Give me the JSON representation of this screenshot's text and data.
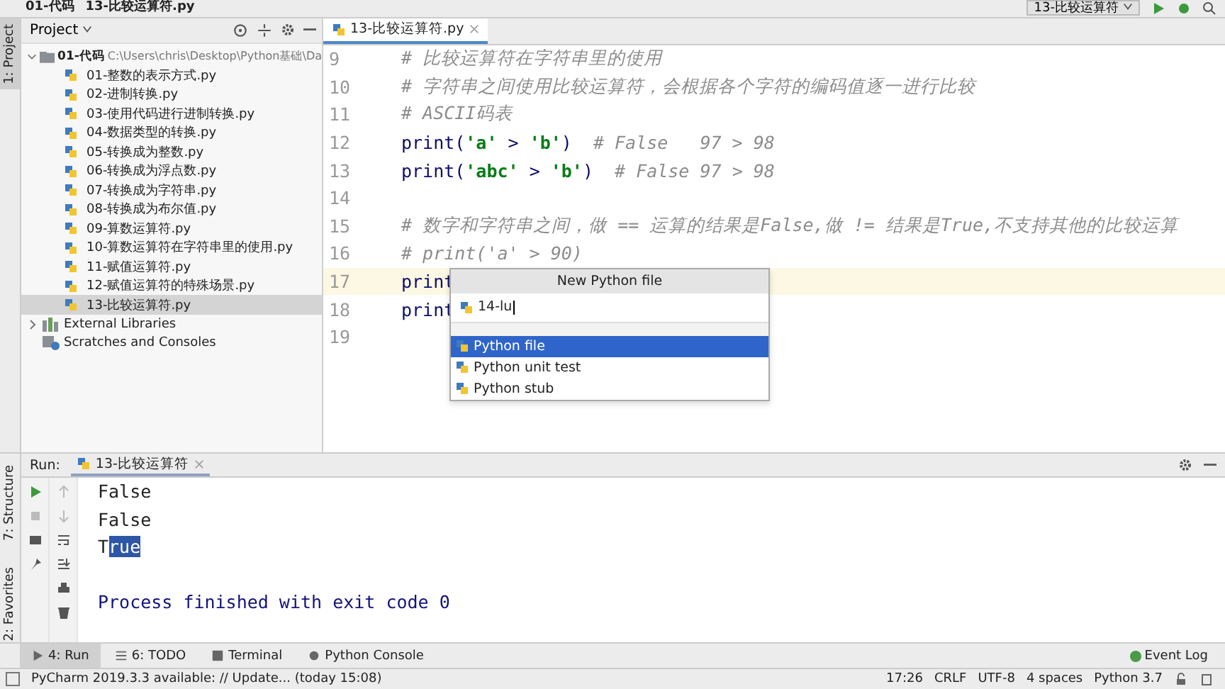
{
  "breadcrumb": [
    "01-代码",
    "13-比较运算符.py"
  ],
  "run_config": "13-比较运算符",
  "left_tool_tabs": [
    {
      "label": "1: Project",
      "selected": true
    },
    {
      "label": "7: Structure",
      "selected": false
    },
    {
      "label": "2: Favorites",
      "selected": false
    }
  ],
  "project": {
    "title": "Project",
    "root": {
      "name": "01-代码",
      "path": "C:\\Users\\chris\\Desktop\\Python基础\\Da",
      "expanded": true,
      "children": [
        {
          "name": "01-整数的表示方式.py",
          "selected": false
        },
        {
          "name": "02-进制转换.py",
          "selected": false
        },
        {
          "name": "03-使用代码进行进制转换.py",
          "selected": false
        },
        {
          "name": "04-数据类型的转换.py",
          "selected": false
        },
        {
          "name": "05-转换成为整数.py",
          "selected": false
        },
        {
          "name": "06-转换成为浮点数.py",
          "selected": false
        },
        {
          "name": "07-转换成为字符串.py",
          "selected": false
        },
        {
          "name": "08-转换成为布尔值.py",
          "selected": false
        },
        {
          "name": "09-算数运算符.py",
          "selected": false
        },
        {
          "name": "10-算数运算符在字符串里的使用.py",
          "selected": false
        },
        {
          "name": "11-赋值运算符.py",
          "selected": false
        },
        {
          "name": "12-赋值运算符的特殊场景.py",
          "selected": false
        },
        {
          "name": "13-比较运算符.py",
          "selected": true
        }
      ]
    },
    "others": [
      {
        "name": "External Libraries",
        "kind": "library"
      },
      {
        "name": "Scratches and Consoles",
        "kind": "scratch"
      }
    ]
  },
  "editor": {
    "tab": "13-比较运算符.py",
    "lines": [
      {
        "number": "9",
        "current": false,
        "segments": [
          {
            "kind": "comment",
            "text": "# 比较运算符在字符串里的使用"
          }
        ]
      },
      {
        "number": "10",
        "current": false,
        "segments": [
          {
            "kind": "comment",
            "text": "# 字符串之间使用比较运算符，会根据各个字符的编码值逐一进行比较"
          }
        ]
      },
      {
        "number": "11",
        "current": false,
        "segments": [
          {
            "kind": "comment",
            "text": "# ASCII码表"
          }
        ]
      },
      {
        "number": "12",
        "current": false,
        "segments": [
          {
            "kind": "plain",
            "text": "print("
          },
          {
            "kind": "string",
            "text": "'a'"
          },
          {
            "kind": "plain",
            "text": " > "
          },
          {
            "kind": "string",
            "text": "'b'"
          },
          {
            "kind": "plain",
            "text": ")  "
          },
          {
            "kind": "comment",
            "text": "# False   97 > 98"
          }
        ]
      },
      {
        "number": "13",
        "current": false,
        "segments": [
          {
            "kind": "plain",
            "text": "print("
          },
          {
            "kind": "string",
            "text": "'abc'"
          },
          {
            "kind": "plain",
            "text": " > "
          },
          {
            "kind": "string",
            "text": "'b'"
          },
          {
            "kind": "plain",
            "text": ")  "
          },
          {
            "kind": "comment",
            "text": "# False 97 > 98"
          }
        ]
      },
      {
        "number": "14",
        "current": false
      },
      {
        "number": "15",
        "current": false,
        "segments": [
          {
            "kind": "comment",
            "text": "# 数字和字符串之间，做 == 运算的结果是False,做 != 结果是True,不支持其他的比较运算"
          }
        ]
      },
      {
        "number": "16",
        "current": false,
        "segments": [
          {
            "kind": "comment",
            "text": "# print('a' > 90)"
          }
        ]
      },
      {
        "number": "17",
        "current": true,
        "segments": [
          {
            "kind": "plain",
            "text": "print"
          }
        ]
      },
      {
        "number": "18",
        "current": false,
        "segments": [
          {
            "kind": "plain",
            "text": "print"
          }
        ]
      },
      {
        "number": "19",
        "current": false
      }
    ]
  },
  "popup": {
    "title": "New Python file",
    "value": "14-lu",
    "options": [
      {
        "label": "Python file",
        "selected": true
      },
      {
        "label": "Python unit test",
        "selected": false
      },
      {
        "label": "Python stub",
        "selected": false
      }
    ]
  },
  "run": {
    "label": "Run:",
    "tab": "13-比较运算符",
    "output": [
      {
        "segments": [
          {
            "text": "False",
            "selected": false
          }
        ]
      },
      {
        "segments": [
          {
            "text": "False",
            "selected": false
          }
        ]
      },
      {
        "segments": [
          {
            "text": "T",
            "selected": false
          },
          {
            "text": "rue",
            "selected": true
          }
        ]
      }
    ],
    "exit": "Process finished with exit code 0"
  },
  "bottom_tabs": [
    {
      "label": "4: Run",
      "kind": "run",
      "selected": true
    },
    {
      "label": "6: TODO",
      "kind": "todo",
      "selected": false
    },
    {
      "label": "Terminal",
      "kind": "terminal",
      "selected": false
    },
    {
      "label": "Python Console",
      "kind": "console",
      "selected": false
    }
  ],
  "event_log": "Event Log",
  "status": {
    "message": "PyCharm 2019.3.3 available: // Update... (today 15:08)",
    "items": [
      "17:26",
      "CRLF",
      "UTF-8",
      "4 spaces",
      "Python 3.7"
    ]
  }
}
